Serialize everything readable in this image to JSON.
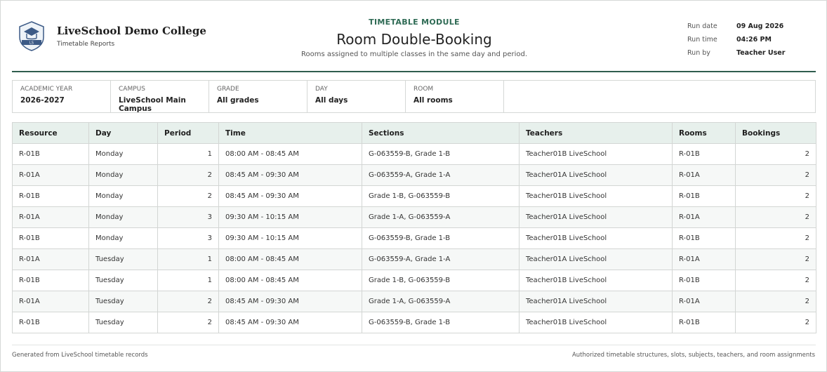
{
  "brand": {
    "name": "LiveSchool Demo College",
    "subtitle": "Timetable Reports",
    "logo_icon": "school-crest-icon",
    "logo_text": "LS"
  },
  "report": {
    "module": "TIMETABLE MODULE",
    "title": "Room Double-Booking",
    "description": "Rooms assigned to multiple classes in the same day and period."
  },
  "run_info": [
    {
      "label": "Run date",
      "value": "09 Aug 2026"
    },
    {
      "label": "Run time",
      "value": "04:26 PM"
    },
    {
      "label": "Run by",
      "value": "Teacher User"
    }
  ],
  "filters": [
    {
      "label": "ACADEMIC YEAR",
      "value": "2026-2027"
    },
    {
      "label": "CAMPUS",
      "value": "LiveSchool Main Campus"
    },
    {
      "label": "GRADE",
      "value": "All grades"
    },
    {
      "label": "DAY",
      "value": "All days"
    },
    {
      "label": "ROOM",
      "value": "All rooms"
    }
  ],
  "table": {
    "headers": [
      "Resource",
      "Day",
      "Period",
      "Time",
      "Sections",
      "Teachers",
      "Rooms",
      "Bookings"
    ],
    "rows": [
      [
        "R-01B",
        "Monday",
        "1",
        "08:00 AM - 08:45 AM",
        "G-063559-B, Grade 1-B",
        "Teacher01B LiveSchool",
        "R-01B",
        "2"
      ],
      [
        "R-01A",
        "Monday",
        "2",
        "08:45 AM - 09:30 AM",
        "G-063559-A, Grade 1-A",
        "Teacher01A LiveSchool",
        "R-01A",
        "2"
      ],
      [
        "R-01B",
        "Monday",
        "2",
        "08:45 AM - 09:30 AM",
        "Grade 1-B, G-063559-B",
        "Teacher01B LiveSchool",
        "R-01B",
        "2"
      ],
      [
        "R-01A",
        "Monday",
        "3",
        "09:30 AM - 10:15 AM",
        "Grade 1-A, G-063559-A",
        "Teacher01A LiveSchool",
        "R-01A",
        "2"
      ],
      [
        "R-01B",
        "Monday",
        "3",
        "09:30 AM - 10:15 AM",
        "G-063559-B, Grade 1-B",
        "Teacher01B LiveSchool",
        "R-01B",
        "2"
      ],
      [
        "R-01A",
        "Tuesday",
        "1",
        "08:00 AM - 08:45 AM",
        "G-063559-A, Grade 1-A",
        "Teacher01A LiveSchool",
        "R-01A",
        "2"
      ],
      [
        "R-01B",
        "Tuesday",
        "1",
        "08:00 AM - 08:45 AM",
        "Grade 1-B, G-063559-B",
        "Teacher01B LiveSchool",
        "R-01B",
        "2"
      ],
      [
        "R-01A",
        "Tuesday",
        "2",
        "08:45 AM - 09:30 AM",
        "Grade 1-A, G-063559-A",
        "Teacher01A LiveSchool",
        "R-01A",
        "2"
      ],
      [
        "R-01B",
        "Tuesday",
        "2",
        "08:45 AM - 09:30 AM",
        "G-063559-B, Grade 1-B",
        "Teacher01B LiveSchool",
        "R-01B",
        "2"
      ]
    ]
  },
  "footer": {
    "left": "Generated from LiveSchool timetable records",
    "right": "Authorized timetable structures, slots, subjects, teachers, and room assignments"
  },
  "colors": {
    "accent": "#2f5d4e",
    "module_text": "#2f6b55",
    "header_bg": "#e7f0ec"
  }
}
